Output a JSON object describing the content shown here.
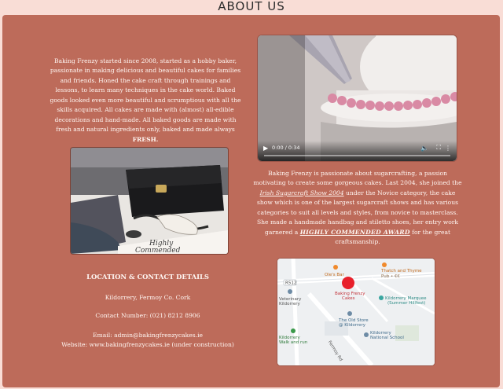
{
  "header": {
    "title": "ABOUT US"
  },
  "about": {
    "p1": "Baking Frenzy started since 2008, started as a hobby baker, passionate in making delicious and beautiful cakes for families and friends. Honed the cake craft through trainings and lessons, to learn many techniques in the cake world. Baked goods looked even more beautiful and scrumptious with all the skills acquired. All cakes are made with (almost) all-edible decorations and hand-made. All baked goods are made with fresh and natural ingredients only, baked and made always ",
    "p1_bold": "FRESH.",
    "p2_a": "Baking Frenzy is passionate about sugarcrafting, a passion motivating to create some gorgeous cakes. Last 2004, she joined the ",
    "p2_link": "Irish Sugarcraft Show 2004",
    "p2_b": " under the Novice category, the cake show which is one of the largest sugarcraft shows and has various categories to suit all levels and styles, from novice to masterclass. She made a handmade handbag and stiletto shoes, her entry work garnered a ",
    "p2_award": "HIGHLY COMMENDED AWARD",
    "p2_c": " for the great craftsmanship."
  },
  "video": {
    "time": "0:00 / 0:34",
    "play_icon": "play-icon",
    "volume_icon": "volume-icon",
    "fullscreen_icon": "fullscreen-icon",
    "menu_icon": "more-options-icon"
  },
  "photo": {
    "card_text_1": "Highly",
    "card_text_2": "Commended"
  },
  "contact": {
    "title": "LOCATION & CONTACT DETAILS",
    "address": "Kildorrery, Fermoy Co. Cork",
    "phone": "Contact Number: (021) 8212 8906",
    "email": "Email: admin@bakingfrenzycakes.ie",
    "website": "Website: www.bakingfrenzycakes.ie (under construction)"
  },
  "map": {
    "labels": {
      "oles_bar": "Ole's Bar",
      "thatch": "Thatch and Thyme",
      "thatch_sub": "Pub • €€",
      "road_code": "R512",
      "baking1": "Baking Frenzy",
      "baking2": "Cakes",
      "vet1": "Veterinary",
      "vet2": "Kildorrery",
      "marquee1": "Kildorrery Marquee",
      "marquee2": "(Summer Hillfest)",
      "oldstore1": "The Old Store",
      "oldstore2": "@ Kildorrery",
      "walk1": "Kildorrery",
      "walk2": "Walk and run",
      "school1": "Kildorrery",
      "school2": "National School",
      "road_name": "Fermoy Rd"
    }
  },
  "colors": {
    "panel": "#bd6b5a",
    "background": "#f9ddd6",
    "text": "#fff6f2",
    "marker": "#e8202b"
  }
}
